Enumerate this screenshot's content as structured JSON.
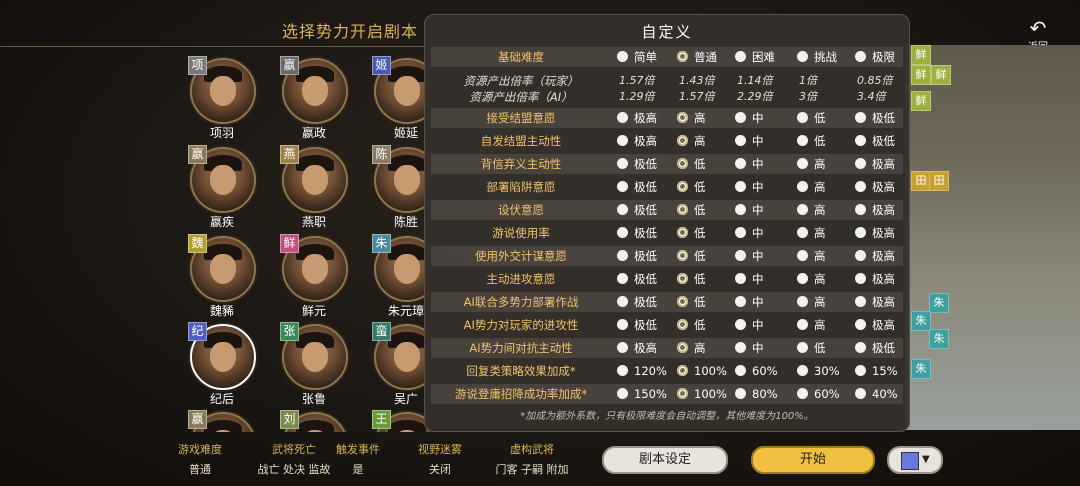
{
  "header": {
    "title": "选择势力开启剧本",
    "back_label": "返回"
  },
  "characters": [
    {
      "name": "项羽",
      "badge": "项",
      "badge_color": "#7a7a7a"
    },
    {
      "name": "嬴政",
      "badge": "嬴",
      "badge_color": "#6a6a6a"
    },
    {
      "name": "姬延",
      "badge": "姬",
      "badge_color": "#4a5ab0"
    },
    {
      "name": "嬴疾",
      "badge": "嬴",
      "badge_color": "#8a7a5a"
    },
    {
      "name": "燕职",
      "badge": "燕",
      "badge_color": "#a0804a"
    },
    {
      "name": "陈胜",
      "badge": "陈",
      "badge_color": "#8a7a6a"
    },
    {
      "name": "魏豨",
      "badge": "魏",
      "badge_color": "#b0a030"
    },
    {
      "name": "鲜元",
      "badge": "鲜",
      "badge_color": "#c05080"
    },
    {
      "name": "朱元璋",
      "badge": "朱",
      "badge_color": "#4a8a9a"
    },
    {
      "name": "纪后",
      "badge": "纪",
      "badge_color": "#5060c0"
    },
    {
      "name": "张鲁",
      "badge": "张",
      "badge_color": "#3a8a5a"
    },
    {
      "name": "吴广",
      "badge": "蛮",
      "badge_color": "#3a7a6a"
    },
    {
      "name": "",
      "badge": "嬴",
      "badge_color": "#8a7a5a"
    },
    {
      "name": "",
      "badge": "刘",
      "badge_color": "#7a8a4a"
    },
    {
      "name": "",
      "badge": "王",
      "badge_color": "#6a9a3a"
    }
  ],
  "map_tiles": [
    {
      "text": "鲜",
      "color": "#a0b040"
    },
    {
      "text": "鲜",
      "color": "#a0b040"
    },
    {
      "text": "鲜",
      "color": "#a0b040"
    },
    {
      "text": "鲜",
      "color": "#a0b040"
    },
    {
      "text": "田",
      "color": "#c8a030"
    },
    {
      "text": "田",
      "color": "#c8a030"
    },
    {
      "text": "朱",
      "color": "#40a0a0"
    },
    {
      "text": "朱",
      "color": "#40a0a0"
    },
    {
      "text": "朱",
      "color": "#40a0a0"
    },
    {
      "text": "朱",
      "color": "#40a0a0"
    }
  ],
  "modal": {
    "title": "自定义",
    "difficulty": {
      "label": "基础难度",
      "options": [
        "简单",
        "普通",
        "困难",
        "挑战",
        "极限"
      ],
      "selected": 1
    },
    "resource_rows": [
      {
        "label": "资源产出倍率（玩家）",
        "values": [
          "1.57倍",
          "1.43倍",
          "1.14倍",
          "1倍",
          "0.85倍"
        ]
      },
      {
        "label": "资源产出倍率（AI）",
        "values": [
          "1.29倍",
          "1.57倍",
          "2.29倍",
          "3倍",
          "3.4倍"
        ]
      }
    ],
    "settings": [
      {
        "label": "接受结盟意愿",
        "options": [
          "极高",
          "高",
          "中",
          "低",
          "极低"
        ],
        "selected": 1
      },
      {
        "label": "自发结盟主动性",
        "options": [
          "极高",
          "高",
          "中",
          "低",
          "极低"
        ],
        "selected": 1
      },
      {
        "label": "背信弃义主动性",
        "options": [
          "极低",
          "低",
          "中",
          "高",
          "极高"
        ],
        "selected": 1
      },
      {
        "label": "部署陷阱意愿",
        "options": [
          "极低",
          "低",
          "中",
          "高",
          "极高"
        ],
        "selected": 1
      },
      {
        "label": "设伏意愿",
        "options": [
          "极低",
          "低",
          "中",
          "高",
          "极高"
        ],
        "selected": 1
      },
      {
        "label": "游说使用率",
        "options": [
          "极低",
          "低",
          "中",
          "高",
          "极高"
        ],
        "selected": 1
      },
      {
        "label": "使用外交计谋意愿",
        "options": [
          "极低",
          "低",
          "中",
          "高",
          "极高"
        ],
        "selected": 1
      },
      {
        "label": "主动进攻意愿",
        "options": [
          "极低",
          "低",
          "中",
          "高",
          "极高"
        ],
        "selected": 1
      },
      {
        "label": "AI联合多势力部署作战",
        "options": [
          "极低",
          "低",
          "中",
          "高",
          "极高"
        ],
        "selected": 1
      },
      {
        "label": "AI势力对玩家的进攻性",
        "options": [
          "极低",
          "低",
          "中",
          "高",
          "极高"
        ],
        "selected": 1
      },
      {
        "label": "AI势力间对抗主动性",
        "options": [
          "极高",
          "高",
          "中",
          "低",
          "极低"
        ],
        "selected": 1
      },
      {
        "label": "回复类策略效果加成*",
        "options": [
          "120%",
          "100%",
          "60%",
          "30%",
          "15%"
        ],
        "selected": 1
      },
      {
        "label": "游说登庸招降成功率加成*",
        "options": [
          "150%",
          "100%",
          "80%",
          "60%",
          "40%"
        ],
        "selected": 1
      }
    ],
    "footnote": "*加成为额外系数，只有极限难度会自动调整，其他难度为100%。"
  },
  "status_bar": [
    {
      "key": "游戏难度",
      "value": "普通"
    },
    {
      "key": "武将死亡",
      "value": "战亡 处决 监故"
    },
    {
      "key": "触发事件",
      "value": "是"
    },
    {
      "key": "视野迷雾",
      "value": "关闭"
    },
    {
      "key": "虚构武将",
      "value": "门客 子嗣 附加"
    }
  ],
  "buttons": {
    "script_settings": "剧本设定",
    "start": "开始",
    "color_swatch": "#6a7ad8"
  }
}
